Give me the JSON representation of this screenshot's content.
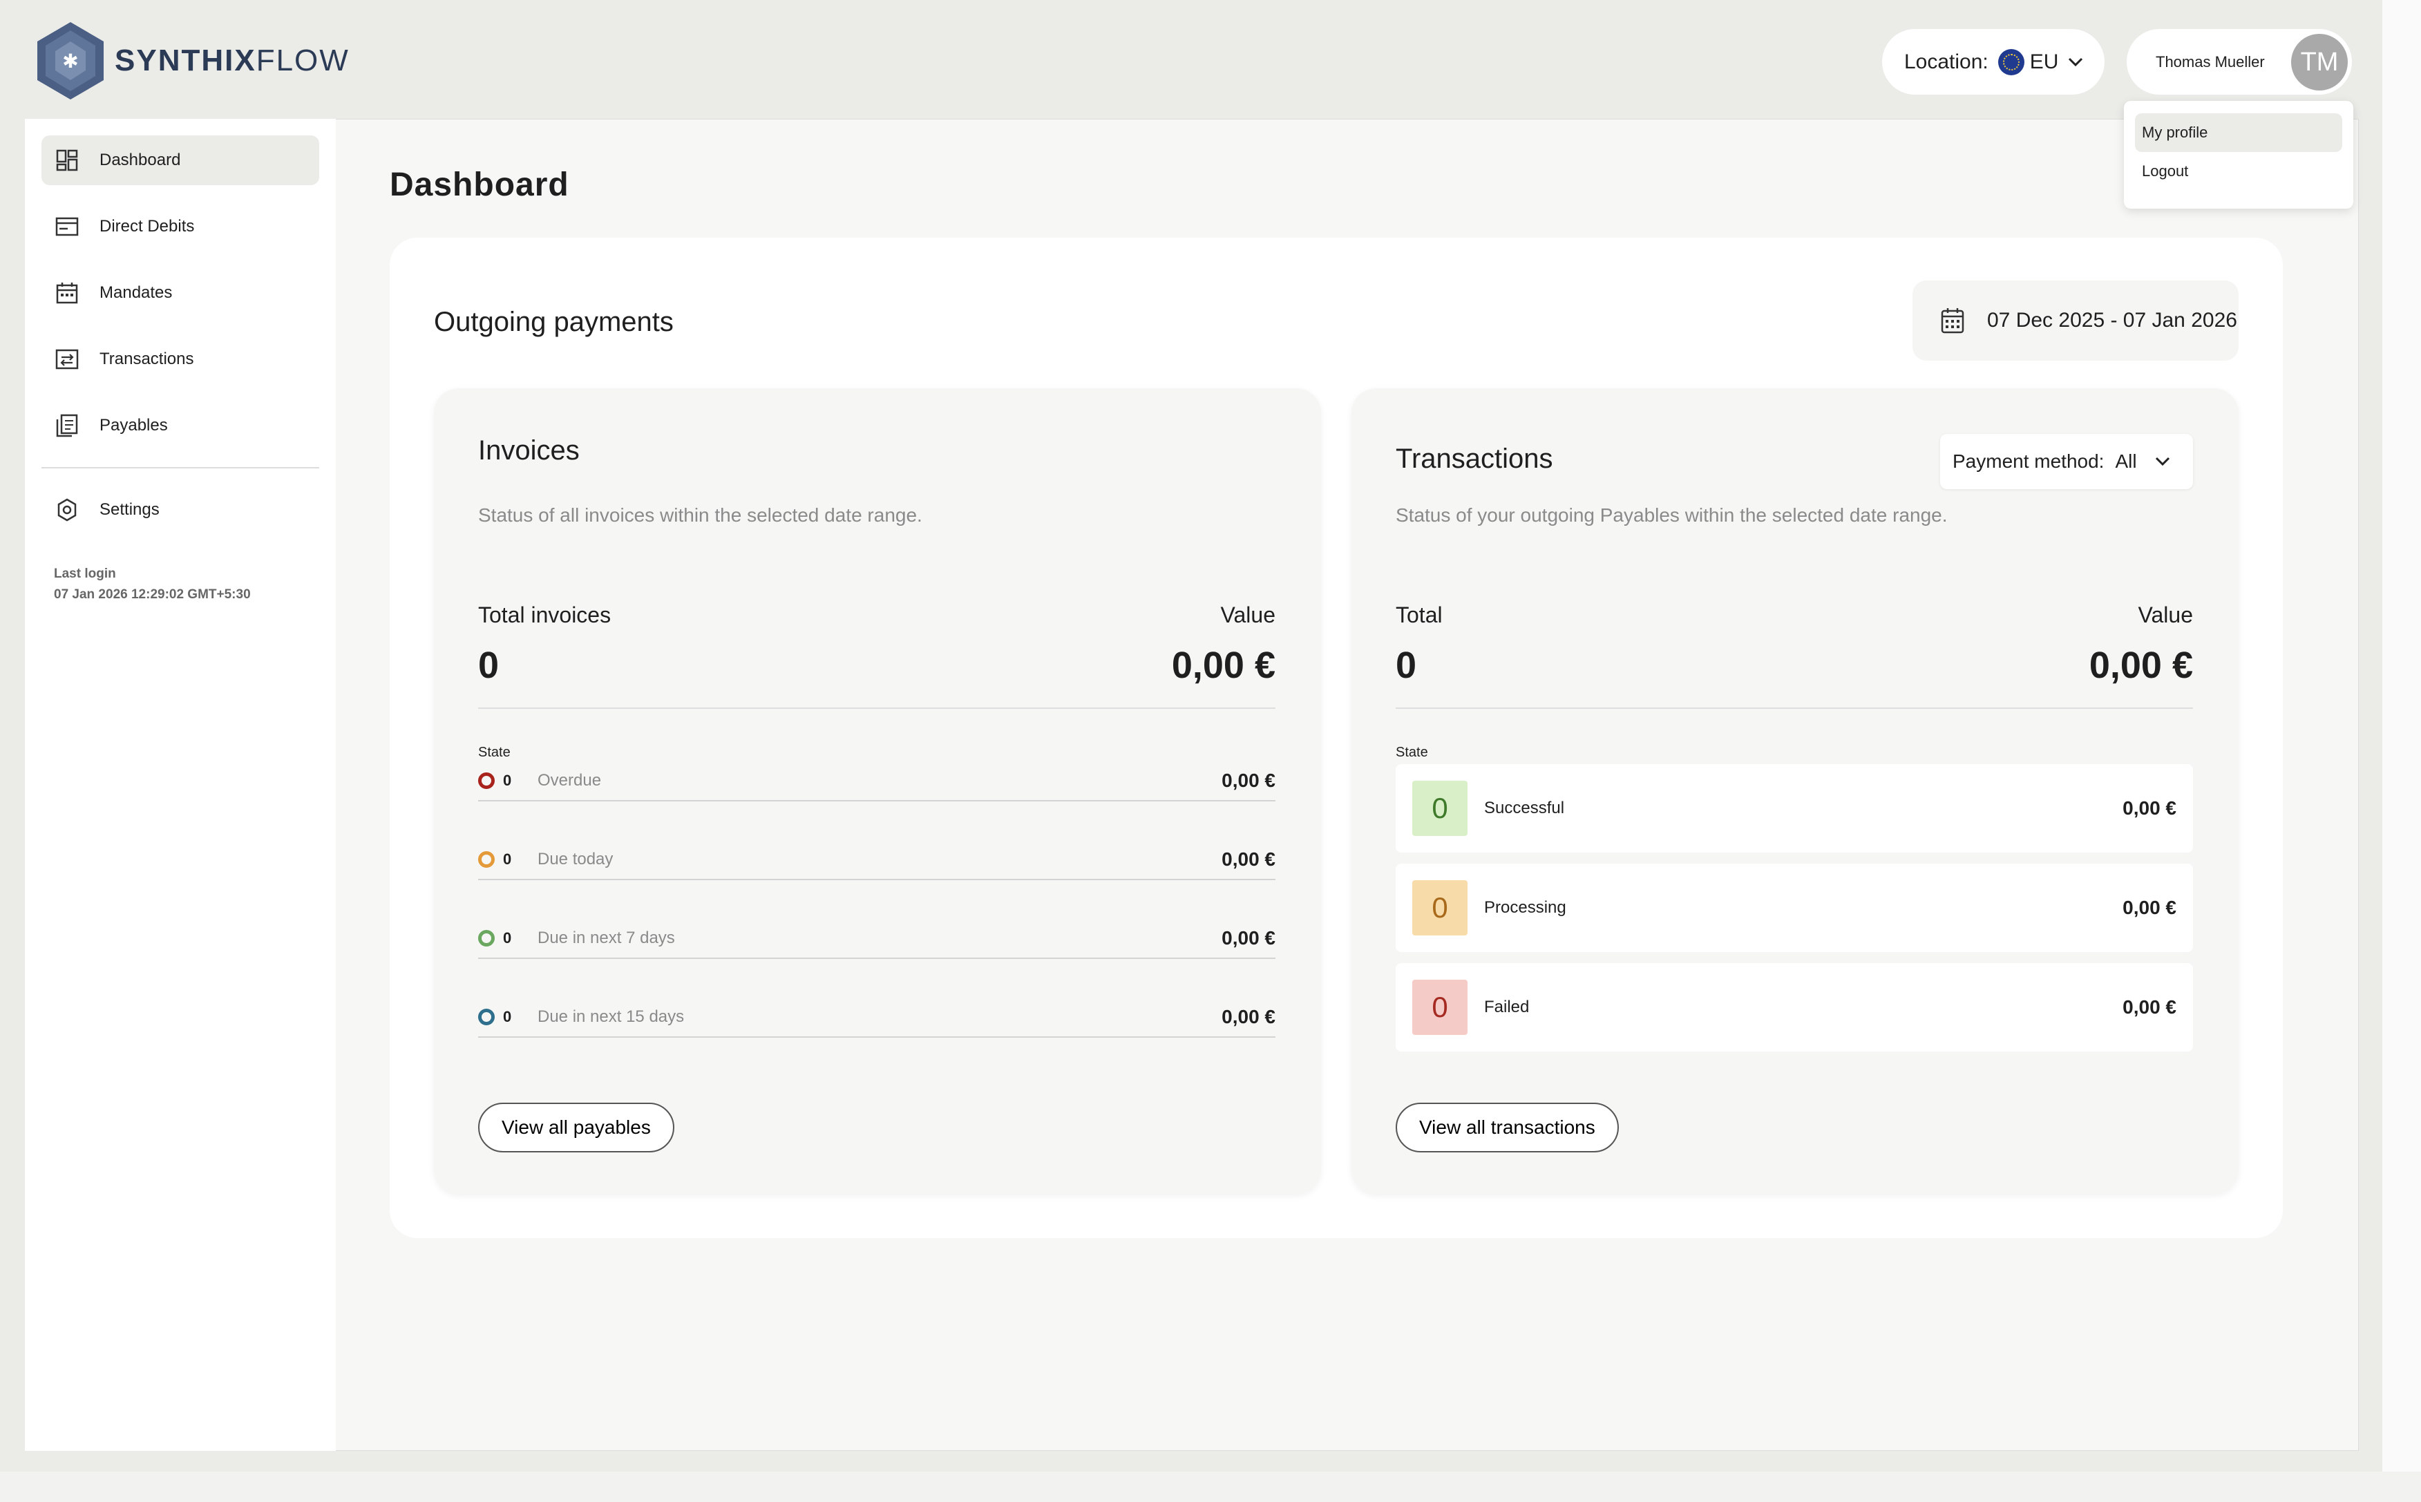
{
  "header": {
    "logo_bold": "SYNTHIX",
    "logo_light": "FLOW",
    "location_label": "Location:",
    "location_value": "EU",
    "user_name": "Thomas Mueller",
    "avatar_initials": "TM"
  },
  "user_menu": {
    "items": [
      {
        "label": "My profile"
      },
      {
        "label": "Logout"
      }
    ]
  },
  "sidebar": {
    "items": [
      {
        "label": "Dashboard",
        "icon": "dashboard-icon"
      },
      {
        "label": "Direct Debits",
        "icon": "credit-card-icon"
      },
      {
        "label": "Mandates",
        "icon": "calendar-icon"
      },
      {
        "label": "Transactions",
        "icon": "transfer-icon"
      },
      {
        "label": "Payables",
        "icon": "documents-icon"
      }
    ],
    "settings_label": "Settings",
    "last_login_label": "Last login",
    "last_login_value": "07 Jan 2026 12:29:02 GMT+5:30"
  },
  "main": {
    "page_title": "Dashboard",
    "section_title": "Outgoing payments",
    "date_range": "07 Dec 2025 - 07 Jan 2026",
    "invoices": {
      "title": "Invoices",
      "subtitle": "Status of all invoices within the selected date range.",
      "total_label": "Total invoices",
      "value_label": "Value",
      "total": "0",
      "value": "0,00 €",
      "state_label": "State",
      "rows": [
        {
          "count": "0",
          "label": "Overdue",
          "amount": "0,00 €",
          "color": "#a8231c"
        },
        {
          "count": "0",
          "label": "Due today",
          "amount": "0,00 €",
          "color": "#e59a3a"
        },
        {
          "count": "0",
          "label": "Due in next 7 days",
          "amount": "0,00 €",
          "color": "#6aa860"
        },
        {
          "count": "0",
          "label": "Due in next 15 days",
          "amount": "0,00 €",
          "color": "#2e6f8e"
        }
      ],
      "button": "View all payables"
    },
    "transactions": {
      "title": "Transactions",
      "subtitle": "Status of your outgoing Payables within the selected date range.",
      "payment_method_label": "Payment method:",
      "payment_method_value": "All",
      "total_label": "Total",
      "value_label": "Value",
      "total": "0",
      "value": "0,00 €",
      "state_label": "State",
      "rows": [
        {
          "count": "0",
          "label": "Successful",
          "amount": "0,00 €",
          "bg": "#d8efc8",
          "fg": "#3f7a2a"
        },
        {
          "count": "0",
          "label": "Processing",
          "amount": "0,00 €",
          "bg": "#f7dcaa",
          "fg": "#a8691a"
        },
        {
          "count": "0",
          "label": "Failed",
          "amount": "0,00 €",
          "bg": "#f5cbc7",
          "fg": "#a52a22"
        }
      ],
      "button": "View all transactions"
    }
  }
}
